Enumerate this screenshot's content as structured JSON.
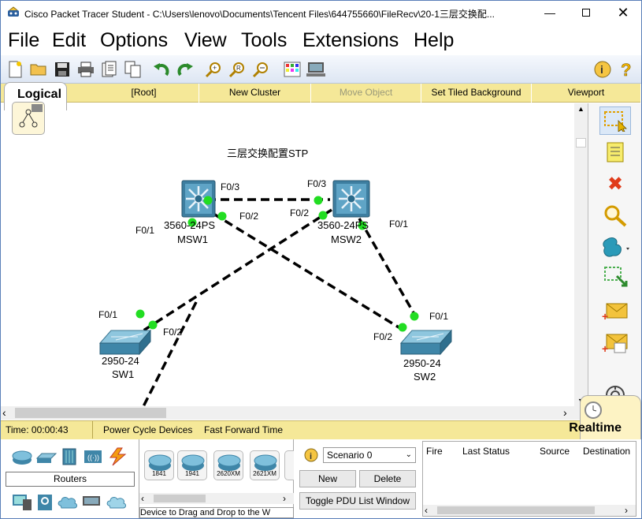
{
  "window": {
    "title": "Cisco Packet Tracer Student - C:\\Users\\lenovo\\Documents\\Tencent Files\\644755660\\FileRecv\\20-1三层交换配..."
  },
  "menu": [
    "File",
    "Edit",
    "Options",
    "View",
    "Tools",
    "Extensions",
    "Help"
  ],
  "logical_bar": {
    "tab_label": "Logical",
    "buttons": [
      "[Root]",
      "New Cluster",
      "Move Object",
      "Set Tiled Background",
      "Viewport"
    ],
    "disabled": "Move Object"
  },
  "workspace": {
    "note": "三层交换配置STP",
    "devices": [
      {
        "model": "3560-24PS",
        "name": "MSW1"
      },
      {
        "model": "3560-24PS",
        "name": "MSW2"
      },
      {
        "model": "2950-24",
        "name": "SW1"
      },
      {
        "model": "2950-24",
        "name": "SW2"
      }
    ],
    "port_labels": {
      "msw1_f03": "F0/3",
      "msw1_f02": "F0/2",
      "msw1_f01": "F0/1",
      "msw2_f03": "F0/3",
      "msw2_f02": "F0/2",
      "msw2_f01": "F0/1",
      "sw1_f01": "F0/1",
      "sw1_f02": "F0/2",
      "sw2_f01": "F0/1",
      "sw2_f02": "F0/2"
    },
    "link_color": "#000000",
    "port_color": "#22dd22"
  },
  "status_bar": {
    "time": "Time: 00:00:43",
    "power_cycle": "Power Cycle Devices",
    "fast_forward": "Fast Forward Time",
    "mode": "Realtime"
  },
  "device_panel": {
    "category_label": "Routers",
    "models": [
      "1841",
      "1941",
      "2620XM",
      "2621XM"
    ],
    "hint": "Device to Drag and Drop to the W"
  },
  "scenario": {
    "selected": "Scenario 0",
    "new_label": "New",
    "delete_label": "Delete",
    "toggle_label": "Toggle PDU List Window"
  },
  "pdu_table": {
    "columns": [
      "Fire",
      "Last Status",
      "Source",
      "Destination"
    ]
  }
}
